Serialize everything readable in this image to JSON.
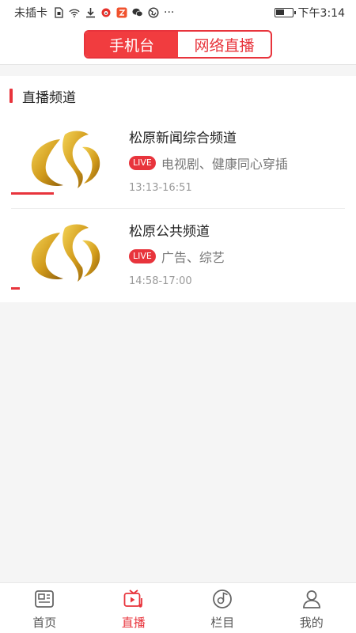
{
  "status_bar": {
    "carrier": "未插卡",
    "time": "下午3:14",
    "battery_level": 0.55,
    "icons": [
      "sim-icon",
      "wifi-icon",
      "download-icon",
      "weibo-icon",
      "app-icon",
      "wechat-icon",
      "browser-icon",
      "more-icon"
    ],
    "more": "···"
  },
  "header": {
    "tabs": [
      {
        "label": "手机台",
        "active": true
      },
      {
        "label": "网络直播",
        "active": false
      }
    ]
  },
  "section": {
    "title": "直播频道"
  },
  "channels": [
    {
      "name": "松原新闻综合频道",
      "badge": "LIVE",
      "description": "电视剧、健康同心穿插",
      "time": "13:13-16:51",
      "progress": 0.3
    },
    {
      "name": "松原公共频道",
      "badge": "LIVE",
      "description": "广告、综艺",
      "time": "14:58-17:00",
      "progress": 0.06
    }
  ],
  "bottom_nav": [
    {
      "label": "首页",
      "icon": "news-icon",
      "active": false
    },
    {
      "label": "直播",
      "icon": "live-tv-icon",
      "active": true
    },
    {
      "label": "栏目",
      "icon": "column-disc-icon",
      "active": false
    },
    {
      "label": "我的",
      "icon": "user-icon",
      "active": false
    }
  ],
  "colors": {
    "accent": "#e8343c",
    "logo_gold": "#d4a017"
  }
}
